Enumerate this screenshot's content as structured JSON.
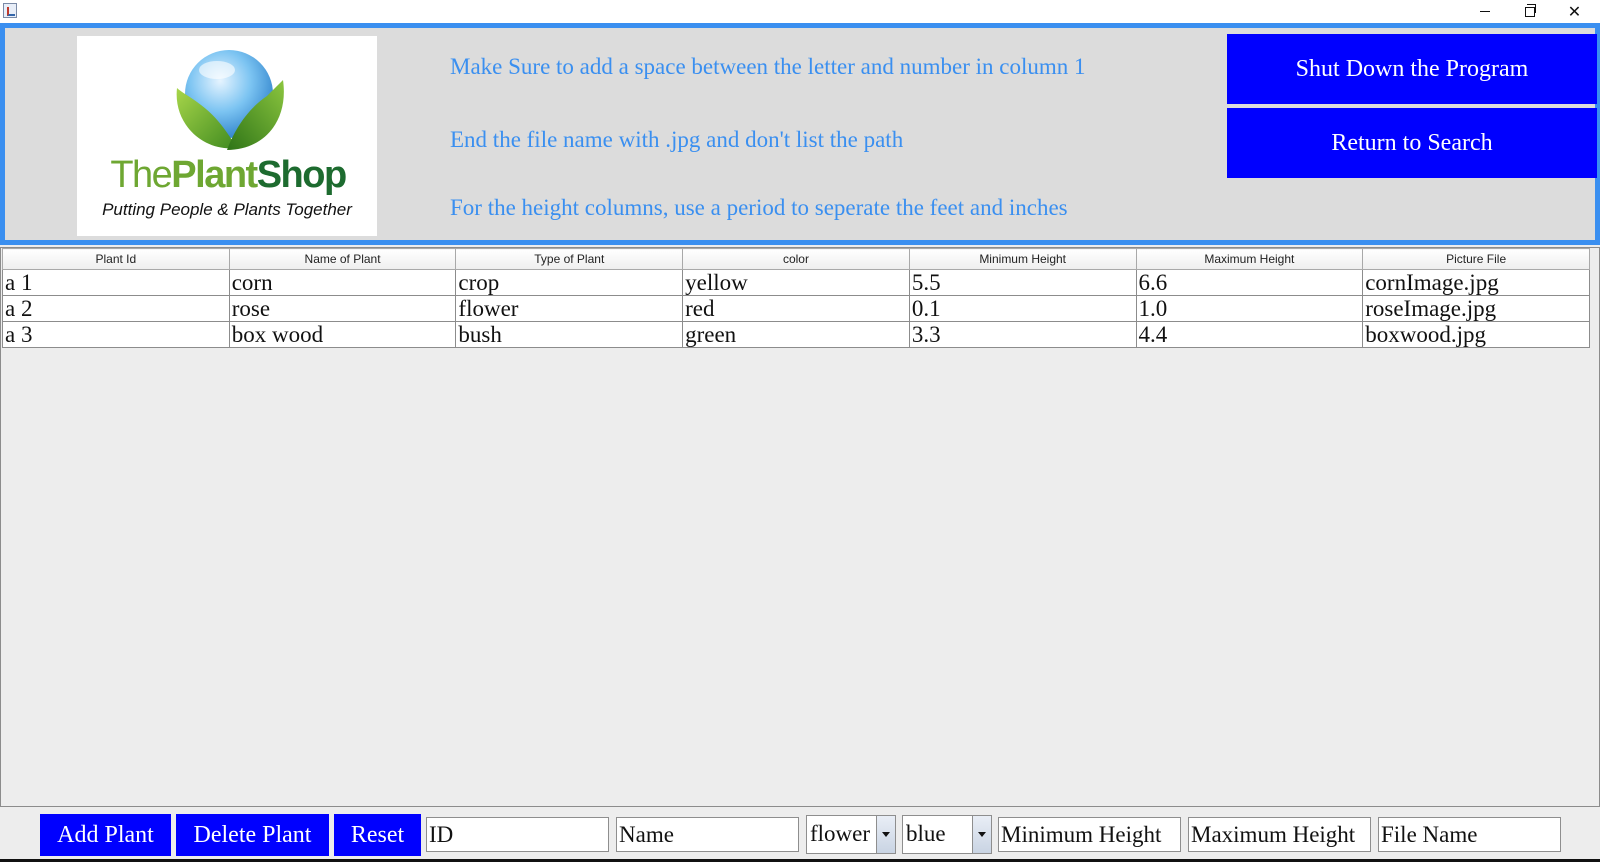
{
  "window": {
    "minimize": "",
    "restore": "",
    "close": "✕"
  },
  "logo": {
    "the": "The",
    "plant": "Plant",
    "shop": "Shop",
    "tagline": "Putting People & Plants Together"
  },
  "notes": [
    "Make Sure to add a space between the letter and number in column 1",
    "End the file name with .jpg and don't list the path",
    "For the height columns, use a period to seperate the feet and inches"
  ],
  "buttons": {
    "shutdown": "Shut Down the Program",
    "return_search": "Return to Search"
  },
  "table": {
    "headers": [
      "Plant Id",
      "Name of Plant",
      "Type of Plant",
      "color",
      "Minimum Height",
      "Maximum Height",
      "Picture File"
    ],
    "rows": [
      [
        "a 1",
        "corn",
        "crop",
        "yellow",
        "5.5",
        "6.6",
        "cornImage.jpg"
      ],
      [
        "a 2",
        "rose",
        "flower",
        "red",
        "0.1",
        "1.0",
        "roseImage.jpg"
      ],
      [
        "a 3",
        "box wood",
        "bush",
        "green",
        "3.3",
        "4.4",
        "boxwood.jpg"
      ]
    ]
  },
  "form": {
    "add": "Add Plant",
    "delete": "Delete Plant",
    "reset": "Reset",
    "id_placeholder": "ID",
    "name_placeholder": "Name",
    "type_selected": "flower",
    "color_selected": "blue",
    "min_placeholder": "Minimum Height",
    "max_placeholder": "Maximum Height",
    "file_placeholder": "File Name"
  },
  "colors": {
    "accent_blue": "#3a8ff0",
    "button_blue": "#0000ff",
    "logo_light_green": "#6ea732",
    "logo_dark_green": "#1d6b2f"
  }
}
